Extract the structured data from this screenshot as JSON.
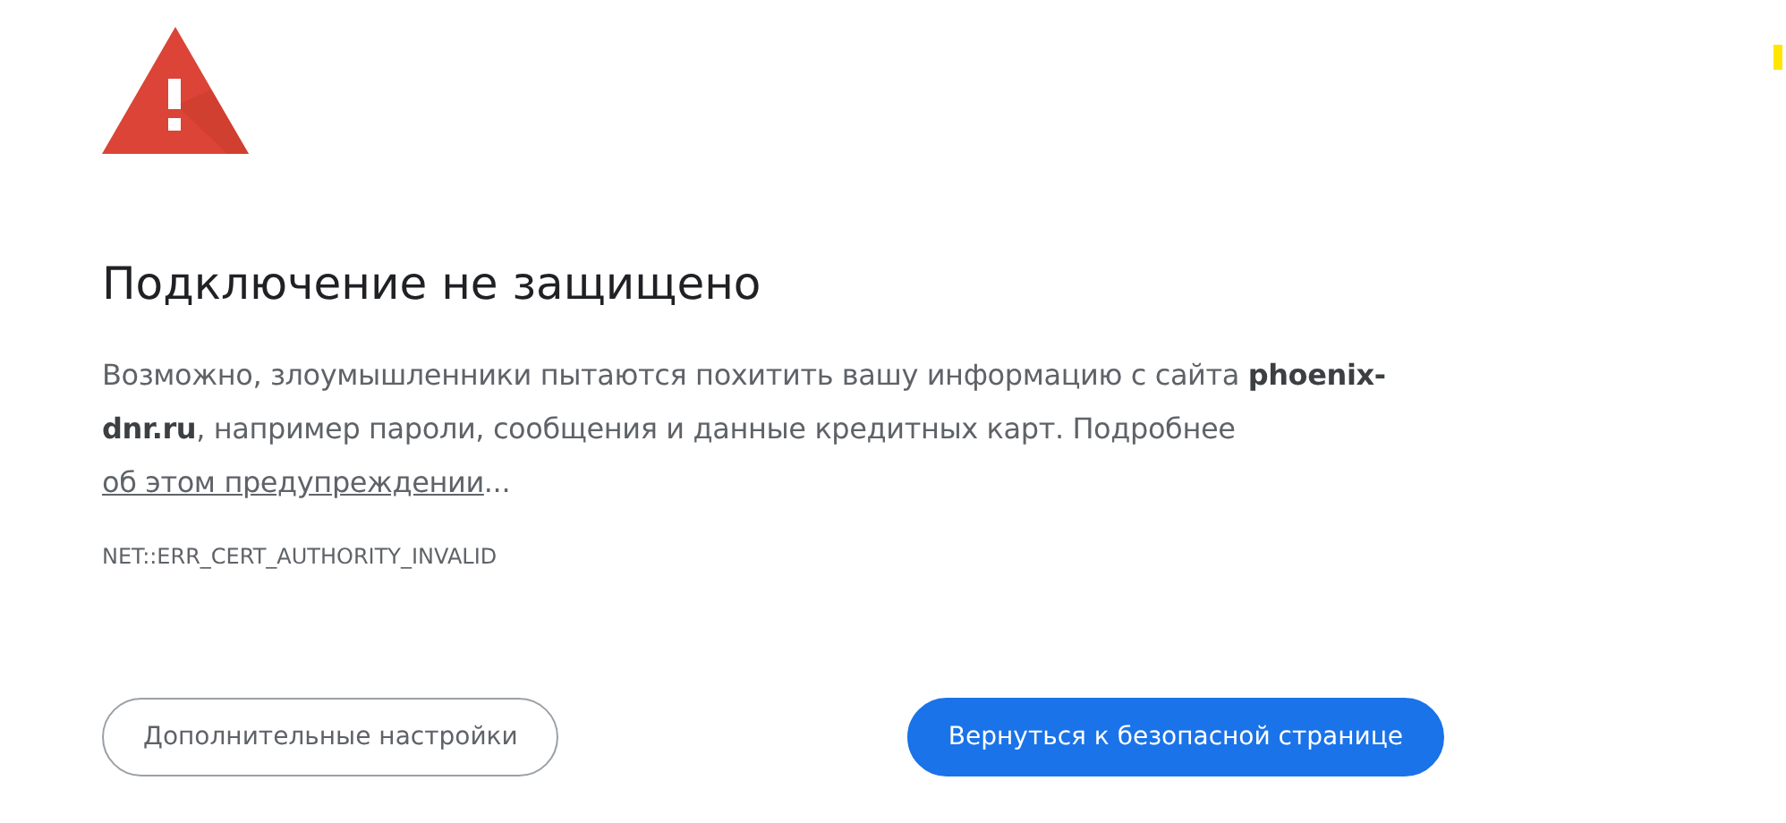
{
  "heading": "Подключение не защищено",
  "message": {
    "before": "Возможно, злоумышленники пытаются похитить вашу информацию с сайта **phoenix-dnr.ru**, например пароли, сообщения и данные кредитных карт. Подробнее",
    "link": "об этом предупреждении",
    "after": "..."
  },
  "error_code": "NET::ERR_CERT_AUTHORITY_INVALID",
  "buttons": [
    {
      "label": "Дополнительные настройки",
      "kind": "secondary"
    },
    {
      "label": "Вернуться к безопасной странице",
      "kind": "primary"
    }
  ]
}
